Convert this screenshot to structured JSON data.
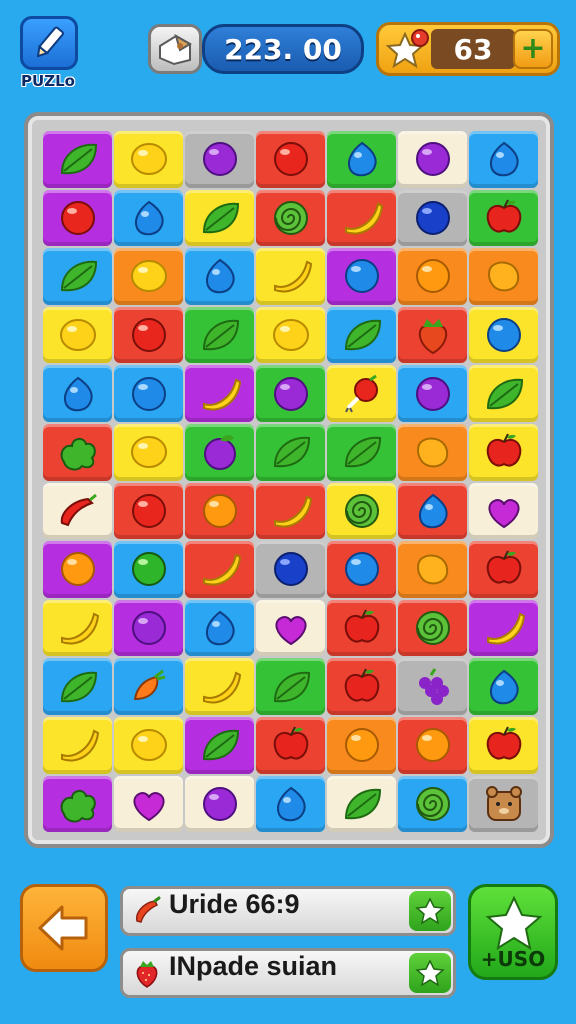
{
  "header": {
    "logo_label": "PUZLo",
    "score": "223. 00",
    "coins": "63",
    "plus_symbol": "+"
  },
  "colors": {
    "background": "#29a9ee",
    "tile_magenta": "#b52ee0",
    "tile_yellow": "#fbe42a",
    "tile_gray": "#b5b5b5",
    "tile_red": "#ec4232",
    "tile_green": "#35c236",
    "tile_cream": "#f7efd8",
    "tile_blue": "#2aa6f2",
    "tile_orange": "#f88a1e"
  },
  "board": {
    "rows": [
      [
        {
          "bg": "magenta",
          "item": "leaf"
        },
        {
          "bg": "yellow",
          "item": "lemon"
        },
        {
          "bg": "gray",
          "item": "grape-ball"
        },
        {
          "bg": "red",
          "item": "red-ball"
        },
        {
          "bg": "green",
          "item": "blue-drop"
        },
        {
          "bg": "cream",
          "item": "grape-ball"
        },
        {
          "bg": "blue",
          "item": "blue-drop"
        }
      ],
      [
        {
          "bg": "magenta",
          "item": "red-ball"
        },
        {
          "bg": "blue",
          "item": "blue-drop"
        },
        {
          "bg": "yellow",
          "item": "leaf"
        },
        {
          "bg": "red",
          "item": "swirl"
        },
        {
          "bg": "red",
          "item": "banana"
        },
        {
          "bg": "gray",
          "item": "dark-blue-ball"
        },
        {
          "bg": "green",
          "item": "apple"
        }
      ],
      [
        {
          "bg": "blue",
          "item": "leaf"
        },
        {
          "bg": "orange",
          "item": "lemon"
        },
        {
          "bg": "blue",
          "item": "blue-drop"
        },
        {
          "bg": "yellow",
          "item": "banana"
        },
        {
          "bg": "magenta",
          "item": "blue-ball"
        },
        {
          "bg": "orange",
          "item": "orange"
        },
        {
          "bg": "orange",
          "item": "mango"
        }
      ],
      [
        {
          "bg": "yellow",
          "item": "lemon"
        },
        {
          "bg": "red",
          "item": "red-ball"
        },
        {
          "bg": "green",
          "item": "leaf"
        },
        {
          "bg": "yellow",
          "item": "lemon"
        },
        {
          "bg": "blue",
          "item": "leaf"
        },
        {
          "bg": "red",
          "item": "strawberry"
        },
        {
          "bg": "yellow",
          "item": "blue-ball"
        }
      ],
      [
        {
          "bg": "blue",
          "item": "blue-drop"
        },
        {
          "bg": "blue",
          "item": "blue-ball"
        },
        {
          "bg": "magenta",
          "item": "banana"
        },
        {
          "bg": "green",
          "item": "grape-ball"
        },
        {
          "bg": "yellow",
          "item": "radish"
        },
        {
          "bg": "blue",
          "item": "grape-ball"
        },
        {
          "bg": "yellow",
          "item": "leaf"
        }
      ],
      [
        {
          "bg": "red",
          "item": "bush"
        },
        {
          "bg": "yellow",
          "item": "lemon"
        },
        {
          "bg": "green",
          "item": "plum"
        },
        {
          "bg": "green",
          "item": "leaf"
        },
        {
          "bg": "green",
          "item": "leaf"
        },
        {
          "bg": "orange",
          "item": "mango"
        },
        {
          "bg": "yellow",
          "item": "apple"
        }
      ],
      [
        {
          "bg": "cream",
          "item": "chili"
        },
        {
          "bg": "red",
          "item": "red-ball"
        },
        {
          "bg": "red",
          "item": "orange"
        },
        {
          "bg": "red",
          "item": "banana"
        },
        {
          "bg": "yellow",
          "item": "swirl"
        },
        {
          "bg": "red",
          "item": "blue-drop"
        },
        {
          "bg": "cream",
          "item": "heart"
        }
      ],
      [
        {
          "bg": "magenta",
          "item": "orange"
        },
        {
          "bg": "blue",
          "item": "green-ball"
        },
        {
          "bg": "red",
          "item": "banana"
        },
        {
          "bg": "gray",
          "item": "dark-blue-ball"
        },
        {
          "bg": "red",
          "item": "blue-ball"
        },
        {
          "bg": "orange",
          "item": "mango"
        },
        {
          "bg": "red",
          "item": "apple"
        }
      ],
      [
        {
          "bg": "yellow",
          "item": "banana"
        },
        {
          "bg": "magenta",
          "item": "grape-ball"
        },
        {
          "bg": "blue",
          "item": "blue-drop"
        },
        {
          "bg": "cream",
          "item": "heart"
        },
        {
          "bg": "red",
          "item": "apple"
        },
        {
          "bg": "red",
          "item": "swirl"
        },
        {
          "bg": "magenta",
          "item": "banana"
        }
      ],
      [
        {
          "bg": "blue",
          "item": "leaf"
        },
        {
          "bg": "blue",
          "item": "carrot"
        },
        {
          "bg": "yellow",
          "item": "banana"
        },
        {
          "bg": "green",
          "item": "leaf"
        },
        {
          "bg": "red",
          "item": "apple"
        },
        {
          "bg": "gray",
          "item": "grapes"
        },
        {
          "bg": "green",
          "item": "blue-drop"
        }
      ],
      [
        {
          "bg": "yellow",
          "item": "banana"
        },
        {
          "bg": "yellow",
          "item": "lemon"
        },
        {
          "bg": "magenta",
          "item": "leaf"
        },
        {
          "bg": "red",
          "item": "apple"
        },
        {
          "bg": "orange",
          "item": "orange"
        },
        {
          "bg": "red",
          "item": "orange"
        },
        {
          "bg": "yellow",
          "item": "apple"
        }
      ],
      [
        {
          "bg": "magenta",
          "item": "bush"
        },
        {
          "bg": "cream",
          "item": "heart"
        },
        {
          "bg": "cream",
          "item": "grape-ball"
        },
        {
          "bg": "blue",
          "item": "blue-drop"
        },
        {
          "bg": "cream",
          "item": "leaf"
        },
        {
          "bg": "blue",
          "item": "swirl"
        },
        {
          "bg": "gray",
          "item": "bear"
        }
      ]
    ]
  },
  "goals": [
    {
      "icon": "chili-icon",
      "text": "Uride 66:9"
    },
    {
      "icon": "strawberry-icon",
      "text": "INpade suian"
    }
  ],
  "use_button": {
    "label": "+USO"
  }
}
